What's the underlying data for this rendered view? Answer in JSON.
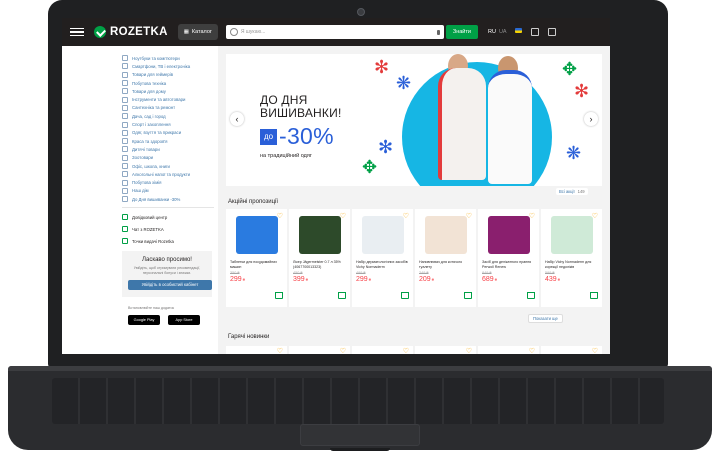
{
  "header": {
    "logo": "ROZETKA",
    "catalog_label": "Каталог",
    "search_placeholder": "Я шукаю...",
    "search_button": "Знайти",
    "lang_ru": "RU",
    "lang_ua": "UA"
  },
  "sidebar": {
    "categories": [
      "Ноутбуки та комп'ютери",
      "Смартфони, ТВ і електроніка",
      "Товари для геймерів",
      "Побутова техніка",
      "Товари для дому",
      "Інструменти та автотовари",
      "Сантехніка та ремонт",
      "Дача, сад і город",
      "Спорт і захоплення",
      "Одяг, взуття та прикраси",
      "Краса та здоров'я",
      "Дитячі товари",
      "Зоотовари",
      "Офіс, школа, книги",
      "Алкогольні напої та продукти",
      "Побутова хімія",
      "Наш дім",
      "До Дня вишиванки -30%"
    ],
    "links": [
      "Довідковий центр",
      "Чат з ROZETKA",
      "Точки видачі Rozetka"
    ],
    "welcome": {
      "title": "Ласкаво просимо!",
      "text": "Увійдіть, щоб отримувати рекомендації, персональні бонуси і знижки.",
      "button": "Увійдіть в особистий кабінет"
    },
    "app_caption": "Встановлюйте наш додаток",
    "stores": [
      "Google Play",
      "App Store"
    ]
  },
  "banner": {
    "line1": "ДО ДНЯ",
    "line2": "ВИШИВАНКИ!",
    "do_label": "до",
    "discount": "-30%",
    "subtitle": "на традиційний одяг",
    "all_actions": "Всі акції",
    "all_actions_count": "149"
  },
  "promotions": {
    "title": "Акційні пропозиції",
    "show_more": "Показати ще",
    "products": [
      {
        "name": "Таблетки для посудомийних машин",
        "old_price": "350 ₴",
        "price": "299",
        "currency": "₴",
        "img_color": "#2a7be0"
      },
      {
        "name": "Лікер Jägermeister 0.7 л 35% (4067700013323)",
        "old_price": "450 ₴",
        "price": "399",
        "currency": "₴",
        "img_color": "#2d4a2a"
      },
      {
        "name": "Набір дерматологічних засобів Vichy Normaderm",
        "old_price": "499 ₴",
        "price": "299",
        "currency": "₴",
        "img_color": "#e9eef2"
      },
      {
        "name": "Наповнювач для котячого туалету",
        "old_price": "249 ₴",
        "price": "209",
        "currency": "₴",
        "img_color": "#f2e3d5"
      },
      {
        "name": "Засіб для делікатного прання Perwoll Renew",
        "old_price": "849 ₴",
        "price": "689",
        "currency": "₴",
        "img_color": "#8a1f6e"
      },
      {
        "name": "Набір Vichy Normaderm для корекції недоліків",
        "old_price": "599 ₴",
        "price": "439",
        "currency": "₴",
        "img_color": "#cfead7"
      }
    ]
  },
  "new_items": {
    "title": "Гарячі новинки"
  },
  "colors": {
    "header_bg": "#221f1f",
    "accent_green": "#00a046",
    "link_blue": "#3e77aa",
    "price_red": "#f84147",
    "banner_blue": "#2a5fd8"
  }
}
